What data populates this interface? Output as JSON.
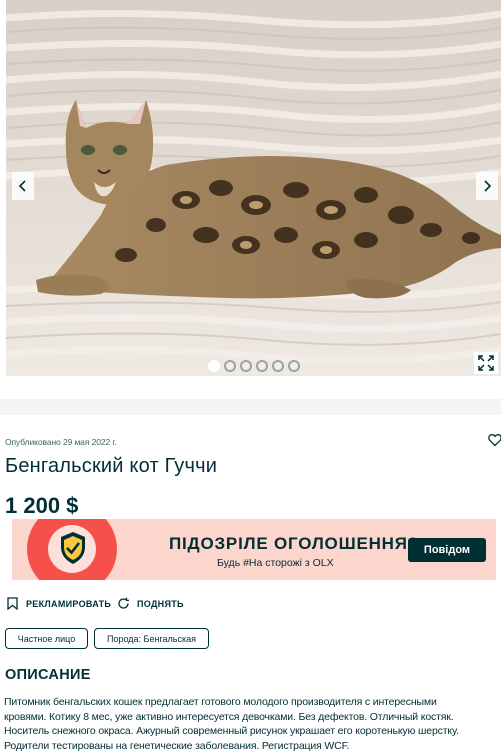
{
  "gallery": {
    "photo": "bengal-cat-photo",
    "dots_total": 6,
    "active_dot": 0,
    "prev_icon": "chevron-left-icon",
    "next_icon": "chevron-right-icon",
    "expand_icon": "expand-icon"
  },
  "listing": {
    "published": "Опубликовано 29 мая 2022 г.",
    "title": "Бенгальский кот Гуччи",
    "price": "1 200 $"
  },
  "banner": {
    "headline": "ПІДОЗРІЛЕ ОГОЛОШЕННЯ?",
    "subtext": "Будь #На сторожі з OLX",
    "button": "Повідом",
    "colors": {
      "background": "#fcd5cd",
      "accent": "#f5514a",
      "button": "#002f34"
    }
  },
  "actions": {
    "promote": "РЕКЛАМИРОВАТЬ",
    "raise": "ПОДНЯТЬ"
  },
  "tags": [
    "Частное лицо",
    "Порода: Бенгальская"
  ],
  "description": {
    "title": "ОПИСАНИЕ",
    "lines": [
      "Питомник бенгальских кошек предлагает готового молодого производителя с интересными",
      "кровями. Котику 8 мес, уже активно интересуется девочками. Без дефектов. Отличный костяк.",
      "Носитель снежного окраса. Ажурный современный рисунок украшает его коротенькую шерстку.",
      "Родители тестированы на генетические заболевания. Регистрация WCF."
    ]
  }
}
